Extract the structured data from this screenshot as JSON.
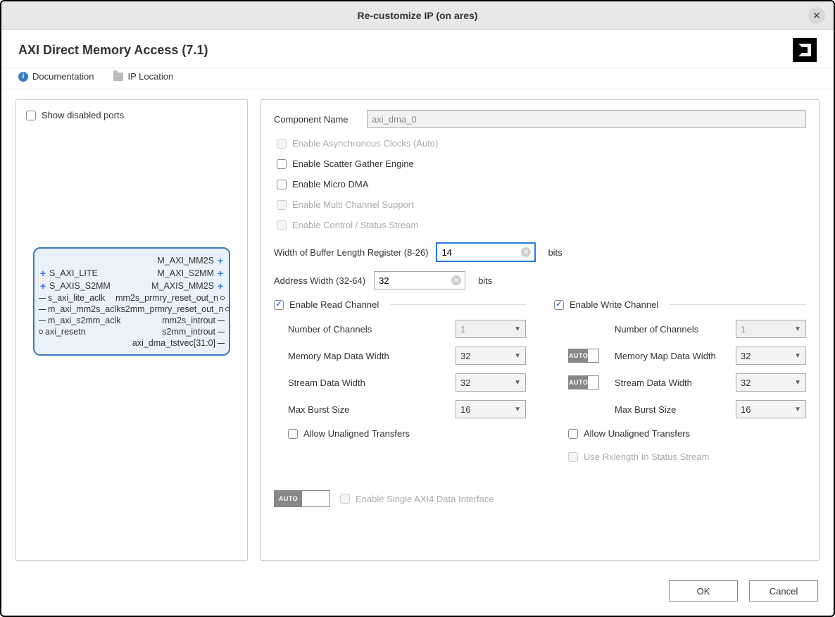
{
  "window": {
    "title": "Re-customize IP (on ares)"
  },
  "page": {
    "title": "AXI Direct Memory Access (7.1)"
  },
  "links": {
    "documentation": "Documentation",
    "ip_location": "IP Location"
  },
  "left": {
    "show_disabled_ports": "Show disabled ports",
    "ports": {
      "left": [
        "S_AXI_LITE",
        "S_AXIS_S2MM",
        "s_axi_lite_aclk",
        "m_axi_mm2s_aclk",
        "m_axi_s2mm_aclk",
        "axi_resetn"
      ],
      "right": [
        "M_AXI_MM2S",
        "M_AXI_S2MM",
        "M_AXIS_MM2S",
        "mm2s_prmry_reset_out_n",
        "s2mm_prmry_reset_out_n",
        "mm2s_introut",
        "s2mm_introut",
        "axi_dma_tstvec[31:0]"
      ]
    }
  },
  "form": {
    "component_name_label": "Component Name",
    "component_name_value": "axi_dma_0",
    "opt_async_clocks": "Enable Asynchronous Clocks (Auto)",
    "opt_sg": "Enable Scatter Gather Engine",
    "opt_micro": "Enable Micro DMA",
    "opt_multi": "Enable Multi Channel Support",
    "opt_ctrl": "Enable Control / Status Stream",
    "buf_len_label": "Width of Buffer Length Register (8-26)",
    "buf_len_value": "14",
    "addr_width_label": "Address Width (32-64)",
    "addr_width_value": "32",
    "bits": "bits",
    "read": {
      "title": "Enable Read Channel",
      "num_ch_label": "Number of Channels",
      "num_ch": "1",
      "mm_width_label": "Memory Map Data Width",
      "mm_width": "32",
      "stream_width_label": "Stream Data Width",
      "stream_width": "32",
      "burst_label": "Max Burst Size",
      "burst": "16",
      "allow_unaligned": "Allow Unaligned Transfers"
    },
    "write": {
      "title": "Enable Write Channel",
      "num_ch_label": "Number of Channels",
      "num_ch": "1",
      "mm_width_label": "Memory Map Data Width",
      "mm_width": "32",
      "stream_width_label": "Stream Data Width",
      "stream_width": "32",
      "burst_label": "Max Burst Size",
      "burst": "16",
      "allow_unaligned": "Allow Unaligned Transfers",
      "use_rxlength": "Use Rxlength In Status Stream"
    },
    "auto": "AUTO",
    "single_axi4": "Enable Single AXI4 Data Interface"
  },
  "footer": {
    "ok": "OK",
    "cancel": "Cancel"
  }
}
